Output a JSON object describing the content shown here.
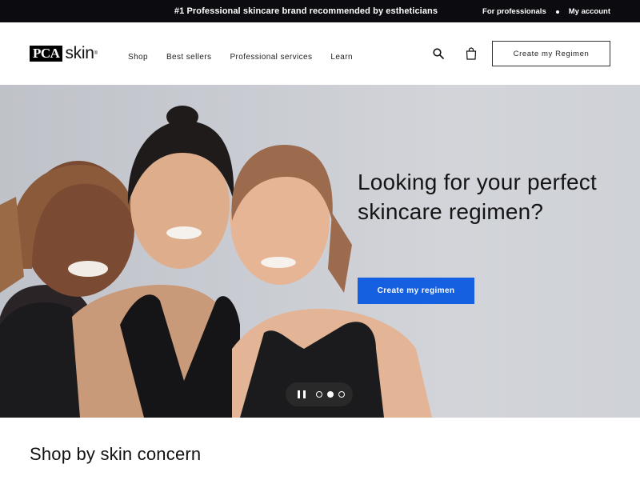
{
  "topbar": {
    "message": "#1 Professional skincare brand recommended by estheticians",
    "links": [
      "For professionals",
      "My account"
    ]
  },
  "header": {
    "logo_box": "PCA",
    "logo_text": "skin",
    "logo_tm": "®",
    "nav": [
      "Shop",
      "Best sellers",
      "Professional services",
      "Learn"
    ],
    "cta_label": "Create my Regimen",
    "icons": [
      "search-icon",
      "shopping-bag-icon"
    ]
  },
  "hero": {
    "title": "Looking for your perfect skincare regimen?",
    "button_label": "Create my regimen",
    "carousel": {
      "slides": 3,
      "active_slide": 2,
      "state": "playing"
    }
  },
  "section": {
    "title": "Shop by skin concern"
  },
  "colors": {
    "topbar_bg": "#0b0b10",
    "accent": "#1560e0",
    "hero_bg": "#c9ccd2"
  }
}
